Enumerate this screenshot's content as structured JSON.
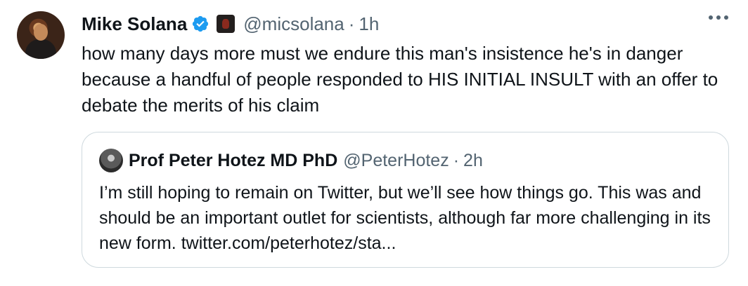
{
  "tweet": {
    "author_name": "Mike Solana",
    "handle": "@micsolana",
    "separator": "·",
    "time": "1h",
    "text": "how many days more must we endure this man's insistence he's in danger because a handful of people responded to HIS INITIAL INSULT with an offer to debate the merits of his claim"
  },
  "quoted_tweet": {
    "author_name": "Prof Peter Hotez MD PhD",
    "handle": "@PeterHotez",
    "separator": "·",
    "time": "2h",
    "text": "I’m still hoping to remain on Twitter, but we’ll see how things go. This was and should be an important outlet for scientists, although far more challenging in its new form. twitter.com/peterhotez/sta..."
  },
  "colors": {
    "text_primary": "#0f1419",
    "text_secondary": "#536471",
    "verified_blue": "#1d9bf0",
    "border": "#cfd9de"
  },
  "icons": [
    "verified-badge-icon",
    "affiliation-badge-icon",
    "more-options-icon"
  ]
}
